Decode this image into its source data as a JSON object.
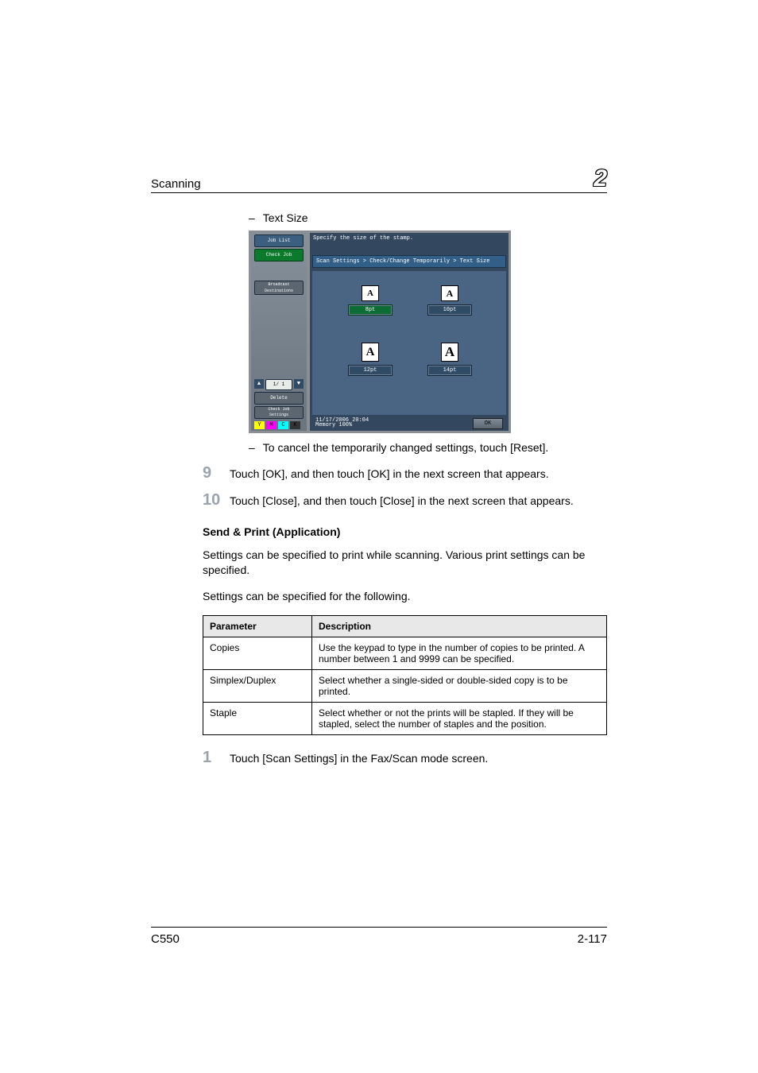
{
  "header": {
    "section": "Scanning",
    "chapter": "2"
  },
  "text_size_label": "Text Size",
  "screenshot": {
    "sidebar": {
      "job_list": "Job List",
      "check_job": "Check Job",
      "broadcast": "Broadcast\nDestinations",
      "page": "1/  1",
      "delete": "Delete",
      "check_settings": "Check Job\nSettings",
      "toners": {
        "y": "Y",
        "m": "M",
        "c": "C",
        "k": "K"
      }
    },
    "title": "Specify the size of the stamp.",
    "breadcrumb": "Scan Settings > Check/Change Temporarily > Text Size",
    "sizes": {
      "a": "8pt",
      "b": "10pt",
      "c": "12pt",
      "d": "14pt",
      "selected": "a"
    },
    "footer": {
      "datetime": "11/17/2006   20:04",
      "memory": "Memory      100%",
      "ok": "OK"
    }
  },
  "cancel_note": "To cancel the temporarily changed settings, touch [Reset].",
  "steps": {
    "s9": {
      "num": "9",
      "text": "Touch [OK], and then touch [OK] in the next screen that appears."
    },
    "s10": {
      "num": "10",
      "text": "Touch [Close], and then touch [Close] in the next screen that appears."
    },
    "s1": {
      "num": "1",
      "text": "Touch [Scan Settings] in the Fax/Scan mode screen."
    }
  },
  "send_print": {
    "heading": "Send & Print (Application)",
    "p1": "Settings can be specified to print while scanning. Various print settings can be specified.",
    "p2": "Settings can be specified for the following."
  },
  "table": {
    "head": {
      "param": "Parameter",
      "desc": "Description"
    },
    "rows": [
      {
        "param": "Copies",
        "desc": "Use the keypad to type in the number of copies to be printed. A number between 1 and 9999 can be specified."
      },
      {
        "param": "Simplex/Duplex",
        "desc": "Select whether a single-sided or double-sided copy is to be printed."
      },
      {
        "param": "Staple",
        "desc": "Select whether or not the prints will be stapled. If they will be stapled, select the number of staples and the position."
      }
    ]
  },
  "footer": {
    "model": "C550",
    "page": "2-117"
  }
}
